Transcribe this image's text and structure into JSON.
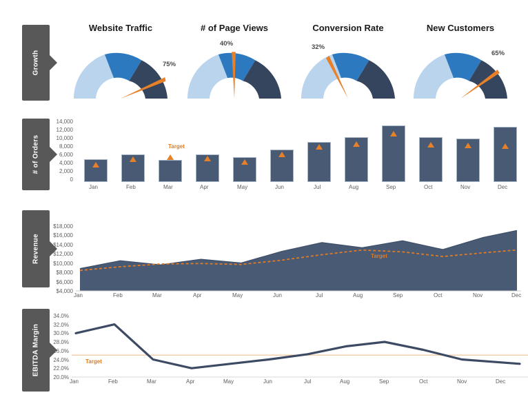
{
  "palette": {
    "band_label_bg": "#585858",
    "navy": "#485a74",
    "gauge_light": "#b9d4ec",
    "gauge_mid": "#2c79bf",
    "gauge_dark": "#36455e",
    "orange": "#e8802a",
    "target_line": "#e07b26",
    "line_navy": "#3d4a63",
    "axis_grey": "#5e5e5e"
  },
  "sections": [
    {
      "id": "growth",
      "label": "Growth"
    },
    {
      "id": "orders",
      "label": "# of Orders"
    },
    {
      "id": "revenue",
      "label": "Revenue"
    },
    {
      "id": "ebitda",
      "label": "EBITDA Margin"
    }
  ],
  "months": [
    "Jan",
    "Feb",
    "Mar",
    "Apr",
    "May",
    "Jun",
    "Jul",
    "Aug",
    "Sep",
    "Oct",
    "Nov",
    "Dec"
  ],
  "target_label": "Target",
  "chart_data": [
    {
      "type": "gauge",
      "title": "Website Traffic",
      "value": 75,
      "value_label": "75%",
      "min": 0,
      "max": 100,
      "bands": [
        {
          "from": 0,
          "to": 33,
          "color": "#b9d4ec"
        },
        {
          "from": 33,
          "to": 66,
          "color": "#2c79bf"
        },
        {
          "from": 66,
          "to": 100,
          "color": "#36455e"
        }
      ],
      "needle_color": "#e8802a"
    },
    {
      "type": "gauge",
      "title": "# of Page Views",
      "value": 40,
      "value_label": "40%",
      "min": 0,
      "max": 100,
      "bands": [
        {
          "from": 0,
          "to": 33,
          "color": "#b9d4ec"
        },
        {
          "from": 33,
          "to": 66,
          "color": "#2c79bf"
        },
        {
          "from": 66,
          "to": 100,
          "color": "#36455e"
        }
      ],
      "needle_color": "#e8802a"
    },
    {
      "type": "gauge",
      "title": "Conversion Rate",
      "value": 32,
      "value_label": "32%",
      "min": 0,
      "max": 100,
      "bands": [
        {
          "from": 0,
          "to": 33,
          "color": "#b9d4ec"
        },
        {
          "from": 33,
          "to": 66,
          "color": "#2c79bf"
        },
        {
          "from": 66,
          "to": 100,
          "color": "#36455e"
        }
      ],
      "needle_color": "#e8802a"
    },
    {
      "type": "gauge",
      "title": "New Customers",
      "value": 65,
      "value_label": "65%",
      "min": 0,
      "max": 100,
      "bands": [
        {
          "from": 0,
          "to": 33,
          "color": "#b9d4ec"
        },
        {
          "from": 33,
          "to": 66,
          "color": "#2c79bf"
        },
        {
          "from": 66,
          "to": 100,
          "color": "#36455e"
        }
      ],
      "needle_color": "#e8802a"
    },
    {
      "type": "bar",
      "title": "",
      "ylabel": "# of Orders",
      "categories": [
        "Jan",
        "Feb",
        "Mar",
        "Apr",
        "May",
        "Jun",
        "Jul",
        "Aug",
        "Sep",
        "Oct",
        "Nov",
        "Dec"
      ],
      "values": [
        5200,
        6400,
        5100,
        6300,
        5700,
        7500,
        9200,
        10400,
        13000,
        10400,
        10100,
        12700
      ],
      "series": [
        {
          "name": "# of Orders",
          "values": [
            5200,
            6400,
            5100,
            6300,
            5700,
            7500,
            9200,
            10400,
            13000,
            10400,
            10100,
            12700
          ]
        },
        {
          "name": "Target",
          "values": [
            4500,
            5900,
            5800,
            6100,
            5300,
            6800,
            8700,
            9400,
            11700,
            9200,
            9000,
            8900
          ]
        }
      ],
      "ylim": [
        0,
        14000
      ],
      "yticks": [
        "0",
        "2,000",
        "4,000",
        "6,000",
        "8,000",
        "10,000",
        "12,000",
        "14,000"
      ],
      "ytick_values": [
        0,
        2000,
        4000,
        6000,
        8000,
        10000,
        12000,
        14000
      ],
      "grid": false,
      "legend": "none",
      "target_marker": "triangle"
    },
    {
      "type": "area",
      "title": "",
      "ylabel": "Revenue",
      "categories": [
        "Jan",
        "Feb",
        "Mar",
        "Apr",
        "May",
        "Jun",
        "Jul",
        "Aug",
        "Sep",
        "Oct",
        "Nov",
        "Dec"
      ],
      "values": [
        8600,
        10300,
        9400,
        10600,
        9800,
        12300,
        14200,
        13100,
        14600,
        12700,
        15300,
        16800
      ],
      "series": [
        {
          "name": "Revenue",
          "values": [
            8600,
            10300,
            9400,
            10600,
            9800,
            12300,
            14200,
            13100,
            14600,
            12700,
            15300,
            16800
          ]
        },
        {
          "name": "Target",
          "values": [
            8200,
            9000,
            9600,
            9700,
            9500,
            10400,
            11600,
            12600,
            12200,
            11200,
            12000,
            12600
          ]
        }
      ],
      "ylim": [
        4000,
        18000
      ],
      "yticks": [
        "$4,000",
        "$6,000",
        "$8,000",
        "$10,000",
        "$12,000",
        "$14,000",
        "$16,000",
        "$18,000"
      ],
      "ytick_values": [
        4000,
        6000,
        8000,
        10000,
        12000,
        14000,
        16000,
        18000
      ],
      "grid": false,
      "legend": "none",
      "annotation": "Target"
    },
    {
      "type": "line",
      "title": "",
      "ylabel": "EBITDA Margin",
      "categories": [
        "Jan",
        "Feb",
        "Mar",
        "Apr",
        "May",
        "Jun",
        "Jul",
        "Aug",
        "Sep",
        "Oct",
        "Nov",
        "Dec"
      ],
      "values": [
        30.0,
        32.0,
        24.0,
        22.0,
        23.0,
        24.0,
        25.2,
        27.0,
        28.0,
        26.2,
        24.0,
        23.0
      ],
      "series": [
        {
          "name": "EBITDA Margin",
          "values": [
            30.0,
            32.0,
            24.0,
            22.0,
            23.0,
            24.0,
            25.2,
            27.0,
            28.0,
            26.2,
            24.0,
            23.0
          ]
        }
      ],
      "target_value": 25.0,
      "ylim": [
        20.0,
        34.0
      ],
      "yticks": [
        "20.0%",
        "22.0%",
        "24.0%",
        "26.0%",
        "28.0%",
        "30.0%",
        "32.0%",
        "34.0%"
      ],
      "ytick_values": [
        20,
        22,
        24,
        26,
        28,
        30,
        32,
        34
      ],
      "grid": false,
      "legend": "none",
      "annotation": "Target"
    }
  ]
}
